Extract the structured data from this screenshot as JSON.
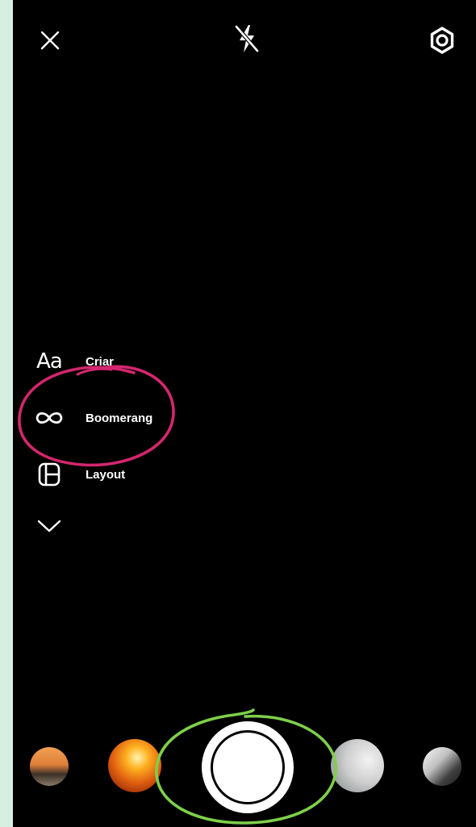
{
  "top_bar": {
    "close_icon": "close-icon",
    "flash_icon": "flash-off-icon",
    "settings_icon": "gear-icon"
  },
  "side_menu": {
    "items": [
      {
        "icon": "text-aa-icon",
        "glyph": "Aa",
        "label": "Criar"
      },
      {
        "icon": "infinity-icon",
        "label": "Boomerang"
      },
      {
        "icon": "layout-icon",
        "label": "Layout"
      }
    ],
    "more_icon": "chevron-down-icon"
  },
  "bottom_bar": {
    "shutter_icon": "shutter-button",
    "thumbnails": [
      "gallery-thumb-beach",
      "gallery-thumb-fire",
      "gallery-thumb-portrait",
      "gallery-thumb-mono"
    ]
  },
  "colors": {
    "background": "#000000",
    "frame": "#d6efe2",
    "annotation_pink": "#d4266e",
    "annotation_green": "#7ecf4a",
    "foreground": "#ffffff"
  }
}
